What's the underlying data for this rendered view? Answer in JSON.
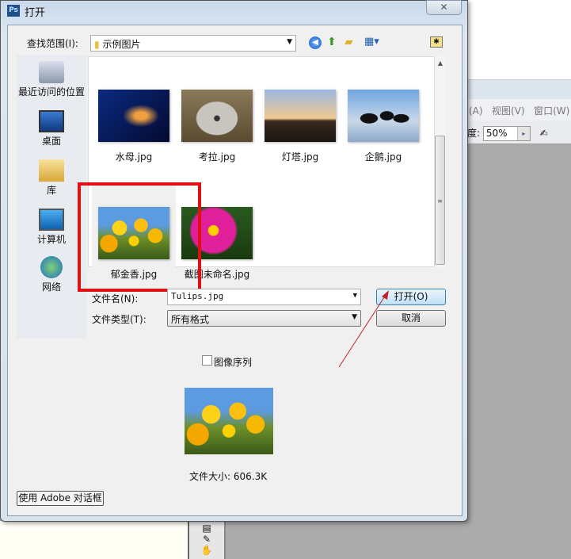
{
  "background_app": {
    "menu": [
      "(A)",
      "视图(V)",
      "窗口(W)"
    ],
    "option_label": "度:",
    "zoom_value": "50%"
  },
  "dialog": {
    "title": "打开",
    "close": "✕",
    "look_in_label": "查找范围(I):",
    "look_in_value": "示例图片",
    "places": [
      "最近访问的位置",
      "桌面",
      "库",
      "计算机",
      "网络"
    ],
    "files": [
      {
        "name": "水母.jpg"
      },
      {
        "name": "考拉.jpg"
      },
      {
        "name": "灯塔.jpg"
      },
      {
        "name": "企鹅.jpg"
      },
      {
        "name": "郁金香.jpg",
        "selected": true
      },
      {
        "name": "截图未命名.jpg"
      }
    ],
    "filename_label": "文件名(N):",
    "filename_value": "Tulips.jpg",
    "filetype_label": "文件类型(T):",
    "filetype_value": "所有格式",
    "open_button": "打开(O)",
    "cancel_button": "取消",
    "image_sequence_label": "图像序列",
    "image_sequence_checked": false,
    "file_size": "文件大小: 606.3K",
    "adobe_dialog_button": "使用 Adobe 对话框"
  },
  "colors": {
    "highlight": "#e01010",
    "arrow": "#c0242c"
  }
}
